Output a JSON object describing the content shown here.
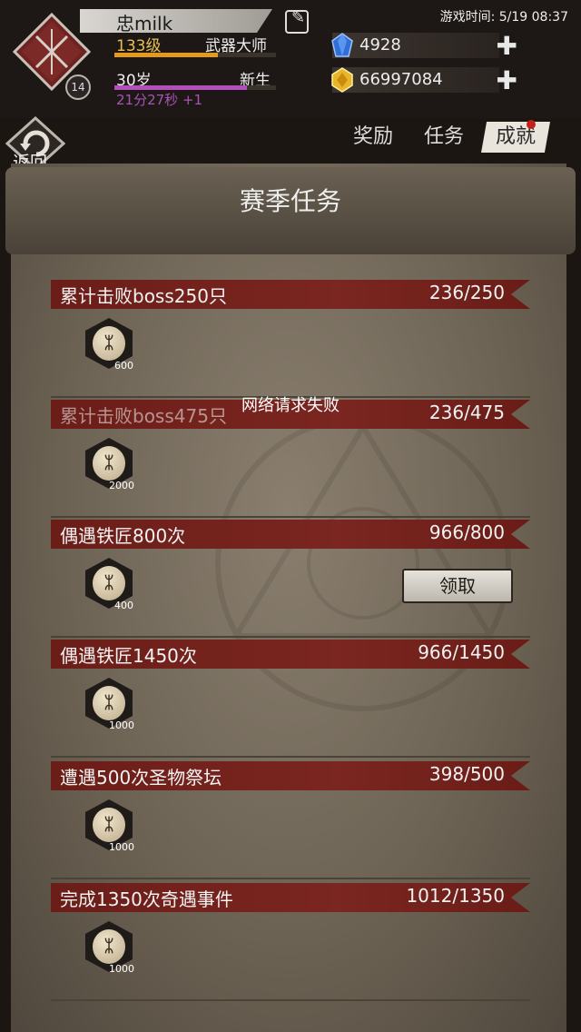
{
  "player": {
    "name": "忠milk",
    "level": "133级",
    "title": "武器大师",
    "level_progress": 0.64,
    "age": "30岁",
    "stage": "新生",
    "age_progress": 0.82,
    "timer": "21分27秒 +1",
    "badge": "14"
  },
  "game_time": "游戏时间: 5/19 08:37",
  "resources": {
    "diamonds": "4928",
    "gold": "66997084"
  },
  "nav": {
    "back_label": "返回",
    "tabs": [
      "奖励",
      "任务",
      "成就"
    ],
    "active_tab": "成就"
  },
  "page_title": "赛季任务",
  "toast": "网络请求失败",
  "tasks": [
    {
      "name": "累计击败boss250只",
      "progress": "236/250",
      "reward_amount": "600"
    },
    {
      "name": "累计击败boss475只",
      "progress": "236/475",
      "reward_amount": "2000"
    },
    {
      "name": "偶遇铁匠800次",
      "progress": "966/800",
      "reward_amount": "400",
      "claim_label": "领取"
    },
    {
      "name": "偶遇铁匠1450次",
      "progress": "966/1450",
      "reward_amount": "1000"
    },
    {
      "name": "遭遇500次圣物祭坛",
      "progress": "398/500",
      "reward_amount": "1000"
    },
    {
      "name": "完成1350次奇遇事件",
      "progress": "1012/1350",
      "reward_amount": "1000"
    }
  ],
  "colors": {
    "banner": "#7b2620",
    "level_bar": "#e39a1d",
    "age_bar": "#b34fbd",
    "level_text": "#e7c04e",
    "notification_dot": "#c0231c"
  }
}
